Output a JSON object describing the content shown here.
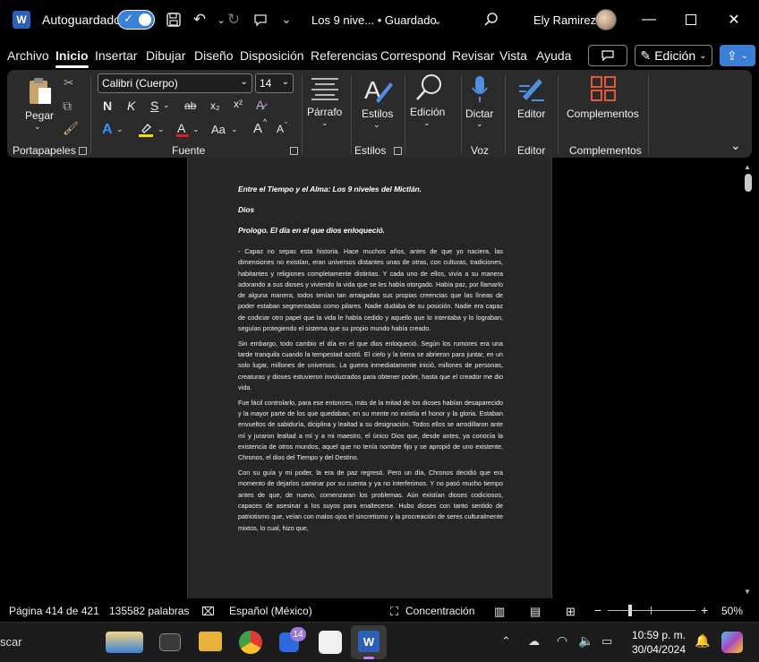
{
  "titlebar": {
    "app_logo": "W",
    "autosave_label": "Autoguardado",
    "autosave_on": true,
    "doc_title": "Los 9 nive... • Guardado",
    "user_name": "Ely Ramirez",
    "icons": [
      "save-icon",
      "undo-icon",
      "redo-icon",
      "touch-mode-icon",
      "customize-icon",
      "search-icon"
    ]
  },
  "tabs": {
    "items": [
      "Archivo",
      "Inicio",
      "Insertar",
      "Dibujar",
      "Diseño",
      "Disposición",
      "Referencias",
      "Correspond",
      "Revisar",
      "Vista",
      "Ayuda"
    ],
    "active": "Inicio",
    "edit_mode_label": "Edición"
  },
  "ribbon": {
    "clipboard": {
      "paste_label": "Pegar",
      "group_label": "Portapapeles"
    },
    "font": {
      "font_name": "Calibri (Cuerpo)",
      "font_size": "14",
      "group_label": "Fuente",
      "bold": "N",
      "italic": "K",
      "underline": "S",
      "strike": "ab",
      "subscript": "x₂",
      "superscript": "x²",
      "change_case": "Aa",
      "grow": "A",
      "shrink": "A"
    },
    "paragraph_label": "Párrafo",
    "styles": {
      "label": "Estilos",
      "group_label": "Estilos"
    },
    "editing_label": "Edición",
    "voice": {
      "label": "Dictar",
      "group_label": "Voz"
    },
    "editor": {
      "label": "Editor",
      "group_label": "Editor"
    },
    "addins": {
      "label": "Complementos",
      "group_label": "Complementos"
    }
  },
  "document": {
    "heading1": "Entre el Tiempo y el Alma: Los 9 niveles del Mictlán.",
    "heading2": "Dios",
    "heading3": "Prologo. El día en el que dios enloqueció.",
    "paragraphs": [
      "- Capaz no sepas esta historia. Hace muchos años, antes de que yo naciera, las dimensiones no existían, eran universos distantes unas de otras, con culturas, tradiciones, habitantes y religiones completamente distintas. Y cada uno de ellos, vivía a su manera adorando a sus dioses y viviendo la vida que se les había otorgado. Había paz, por llamarlo de alguna manera, todos tenían tan arraigadas sus propias creencias que las líneas de poder estaban segmentadas como pilares. Nadie dudaba de su posición. Nadie era capaz de codiciar otro papel que la vida le había cedido y aquello que lo intentaba y lo lograban, seguían protegiendo el sistema que su propio mundo había creado.",
      "Sin embargo, todo cambio el día en el que dios enloqueció. Según los rumores era una tarde tranquila cuando la tempestad azotó. El cielo y la tierra se abrieron para juntar, en un solo lugar, millones de universos. La guerra inmediatamente inició, millones de personas, creaturas y dioses estuvieron involucrados para obtener poder, hasta que el creador me dio vida.",
      "Fue fácil controlarlo, para ese entonces, más de la mitad de los dioses habían desaparecido y la mayor parte de los que quedaban, en su mente no existía el honor y la gloria. Estaban envueltos de sabiduría, diciplina y lealtad a su designación. Todos ellos se arrodillaron ante mí y juraron lealtad a mí y a mi maestro, el único Dios que, desde antes, ya conocía la existencia de otros mundos, aquel que no tenía nombre fijo y se apropió de uno existente, Chronos, el dios del Tiempo y del Destino.",
      "Con su guía y mi poder, la era de paz regresó. Pero un día, Chronos decidió que era momento de dejarlos caminar por su cuenta y ya no interferimos. Y no pasó mucho tiempo antes de que, de nuevo, comenzaran los problemas. Aún existían dioses codiciosos, capaces de asesinar a los suyos para enaltecerse. Hubo dioses con tanto sentido de patriotismo que, veían con malos ojos el sincretismo y la procreación de seres culturalmente mixtos, lo cual, hizo que,"
    ]
  },
  "statusbar": {
    "page": "Página 414 de 421",
    "words": "135582 palabras",
    "language": "Español (México)",
    "focus": "Concentración",
    "zoom_minus": "−",
    "zoom_plus": "+",
    "zoom": "50%"
  },
  "taskbar": {
    "search_partial": "scar",
    "teams_badge": "14",
    "time": "10:59 p. m.",
    "date": "30/04/2024"
  },
  "colors": {
    "accent": "#3c7fd6",
    "ribbon_bg": "#2b2b2b",
    "page_bg": "#262626"
  }
}
